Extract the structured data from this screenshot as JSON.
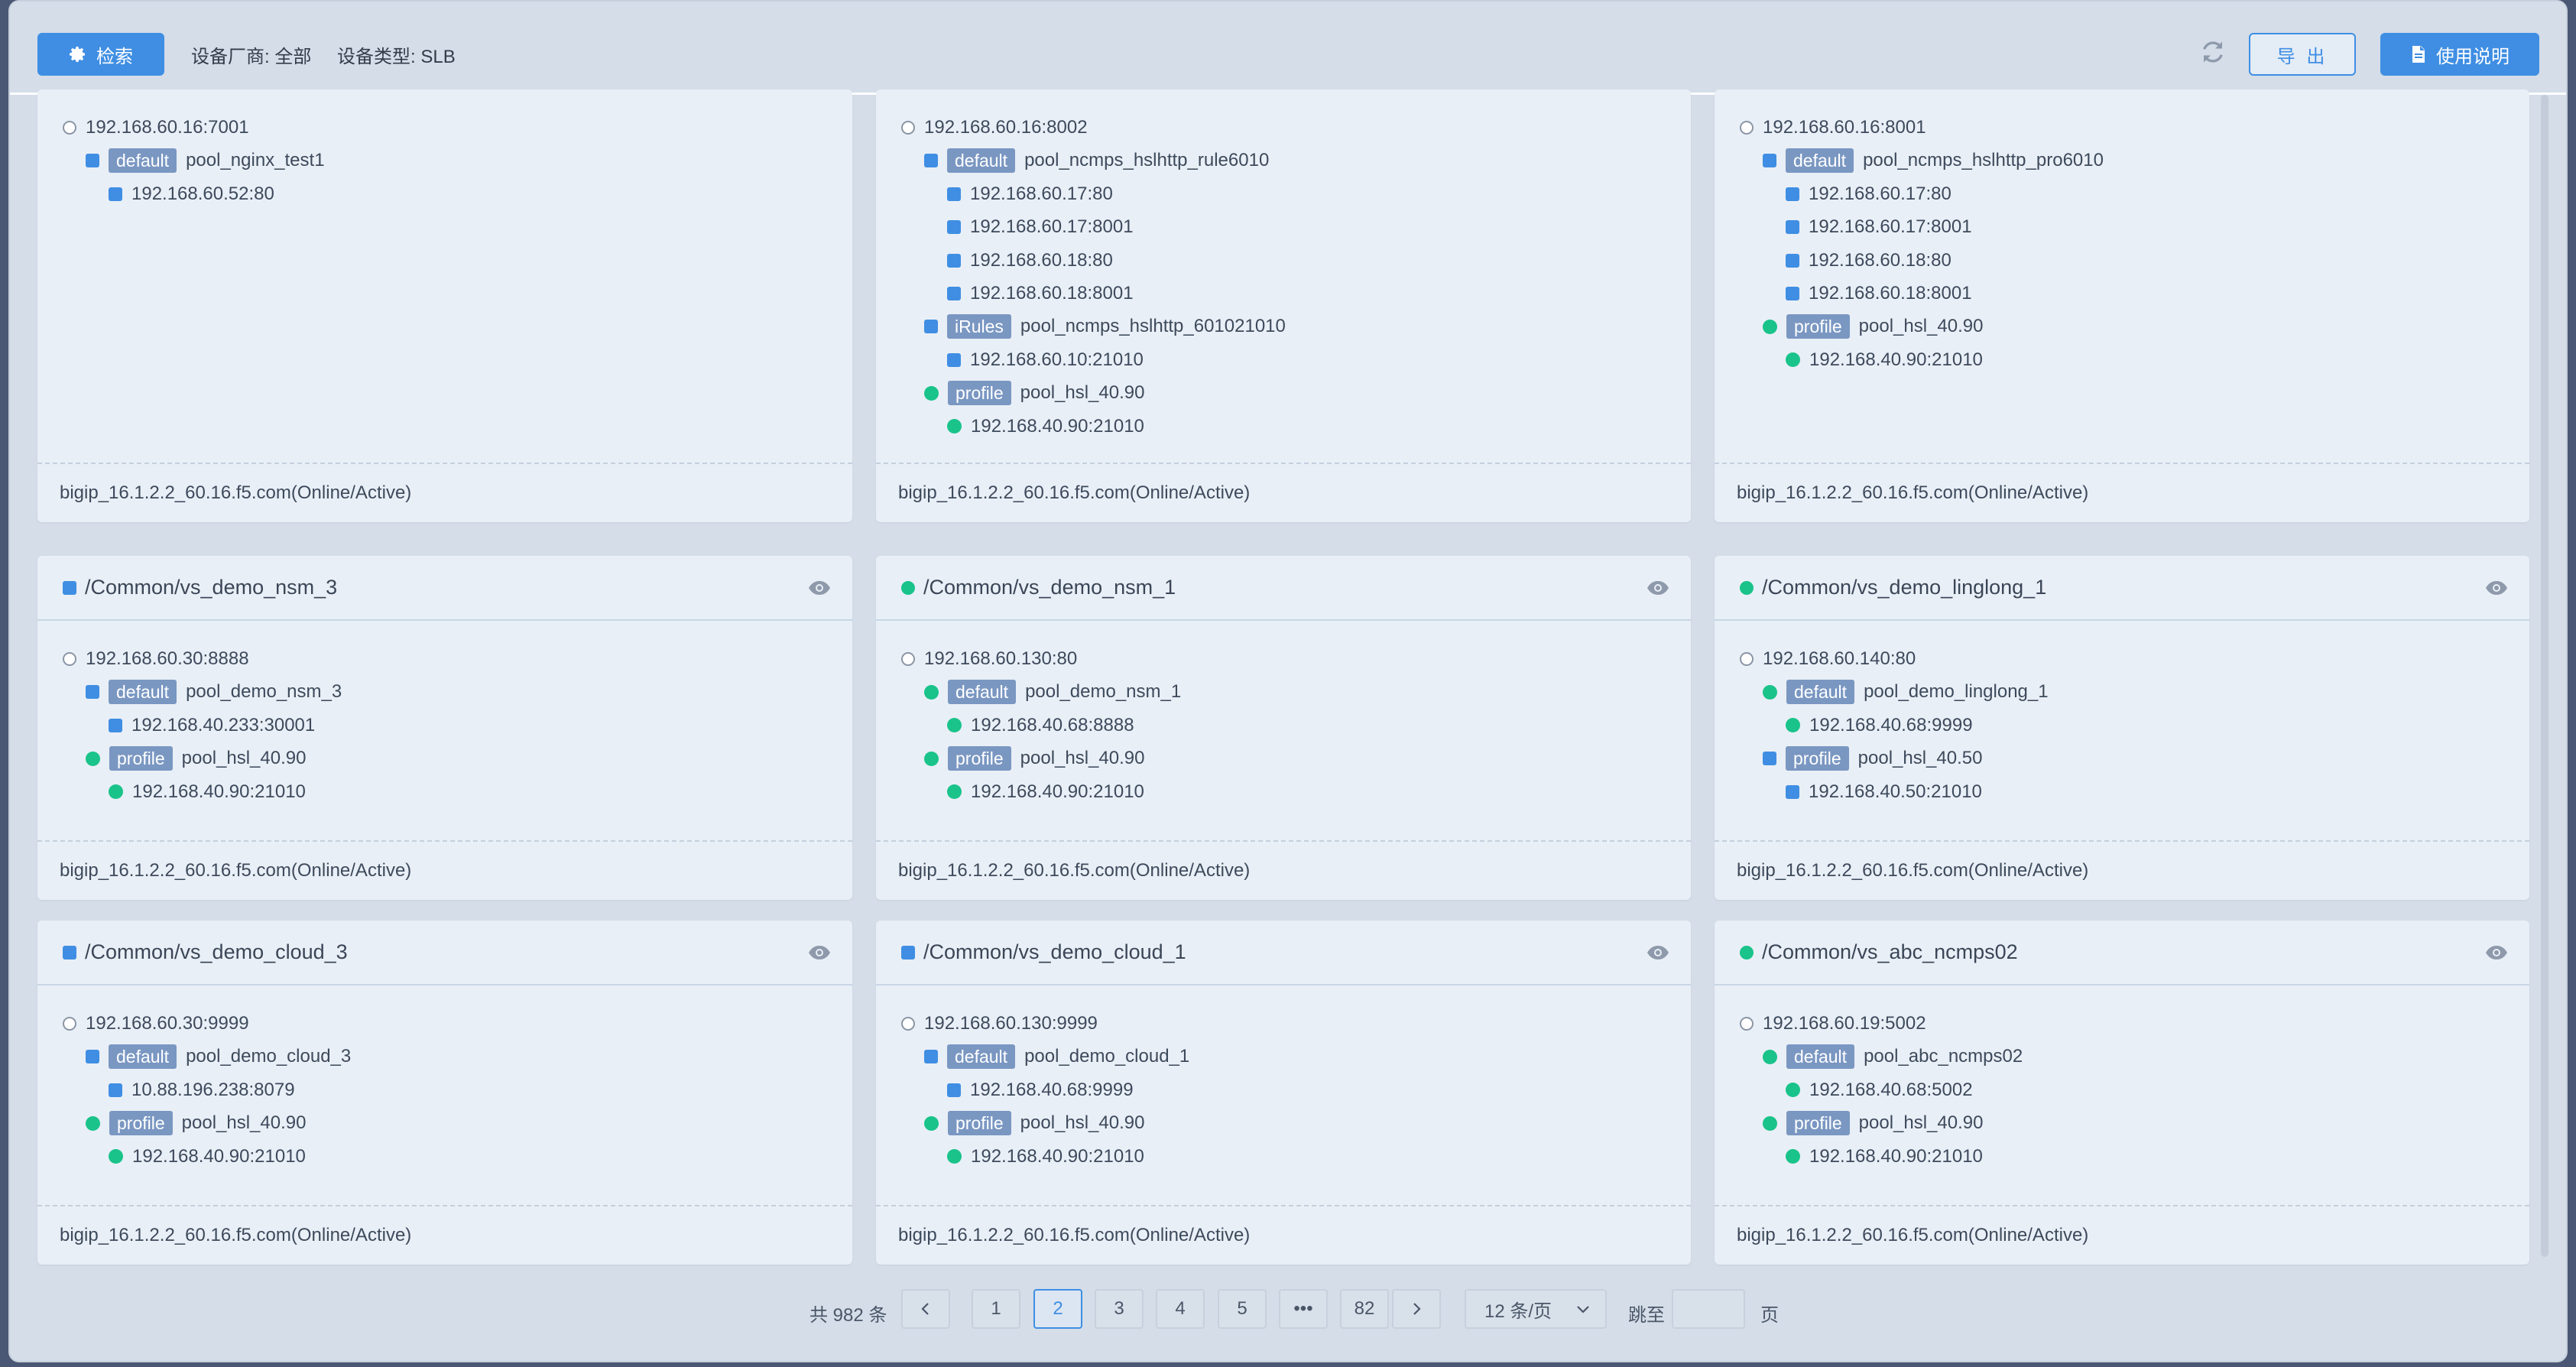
{
  "toolbar": {
    "search_label": "检索",
    "vendor_filter": "设备厂商: 全部",
    "type_filter": "设备类型: SLB",
    "export_label": "导 出",
    "help_label": "使用说明"
  },
  "cards": [
    {
      "title": null,
      "title_status": null,
      "nodes": [
        {
          "kind": "circle",
          "level": 0,
          "text": "192.168.60.16:7001"
        },
        {
          "kind": "square",
          "level": 1,
          "tag": "default",
          "text": "pool_nginx_test1"
        },
        {
          "kind": "square",
          "level": 2,
          "text": "192.168.60.52:80"
        }
      ],
      "footer": "bigip_16.1.2.2_60.16.f5.com(Online/Active)"
    },
    {
      "title": null,
      "title_status": null,
      "nodes": [
        {
          "kind": "circle",
          "level": 0,
          "text": "192.168.60.16:8002"
        },
        {
          "kind": "square",
          "level": 1,
          "tag": "default",
          "text": "pool_ncmps_hslhttp_rule6010"
        },
        {
          "kind": "square",
          "level": 2,
          "text": "192.168.60.17:80"
        },
        {
          "kind": "square",
          "level": 2,
          "text": "192.168.60.17:8001"
        },
        {
          "kind": "square",
          "level": 2,
          "text": "192.168.60.18:80"
        },
        {
          "kind": "square",
          "level": 2,
          "text": "192.168.60.18:8001"
        },
        {
          "kind": "square",
          "level": 1,
          "tag": "iRules",
          "text": "pool_ncmps_hslhttp_601021010"
        },
        {
          "kind": "square",
          "level": 2,
          "text": "192.168.60.10:21010"
        },
        {
          "kind": "dot",
          "level": 1,
          "tag": "profile",
          "text": "pool_hsl_40.90"
        },
        {
          "kind": "dot",
          "level": 2,
          "text": "192.168.40.90:21010"
        }
      ],
      "footer": "bigip_16.1.2.2_60.16.f5.com(Online/Active)"
    },
    {
      "title": null,
      "title_status": null,
      "nodes": [
        {
          "kind": "circle",
          "level": 0,
          "text": "192.168.60.16:8001"
        },
        {
          "kind": "square",
          "level": 1,
          "tag": "default",
          "text": "pool_ncmps_hslhttp_pro6010"
        },
        {
          "kind": "square",
          "level": 2,
          "text": "192.168.60.17:80"
        },
        {
          "kind": "square",
          "level": 2,
          "text": "192.168.60.17:8001"
        },
        {
          "kind": "square",
          "level": 2,
          "text": "192.168.60.18:80"
        },
        {
          "kind": "square",
          "level": 2,
          "text": "192.168.60.18:8001"
        },
        {
          "kind": "dot",
          "level": 1,
          "tag": "profile",
          "text": "pool_hsl_40.90"
        },
        {
          "kind": "dot",
          "level": 2,
          "text": "192.168.40.90:21010"
        }
      ],
      "footer": "bigip_16.1.2.2_60.16.f5.com(Online/Active)"
    },
    {
      "title": "/Common/vs_demo_nsm_3",
      "title_status": "square",
      "nodes": [
        {
          "kind": "circle",
          "level": 0,
          "text": "192.168.60.30:8888"
        },
        {
          "kind": "square",
          "level": 1,
          "tag": "default",
          "text": "pool_demo_nsm_3"
        },
        {
          "kind": "square",
          "level": 2,
          "text": "192.168.40.233:30001"
        },
        {
          "kind": "dot",
          "level": 1,
          "tag": "profile",
          "text": "pool_hsl_40.90"
        },
        {
          "kind": "dot",
          "level": 2,
          "text": "192.168.40.90:21010"
        }
      ],
      "footer": "bigip_16.1.2.2_60.16.f5.com(Online/Active)"
    },
    {
      "title": "/Common/vs_demo_nsm_1",
      "title_status": "dot",
      "nodes": [
        {
          "kind": "circle",
          "level": 0,
          "text": "192.168.60.130:80"
        },
        {
          "kind": "dot",
          "level": 1,
          "tag": "default",
          "text": "pool_demo_nsm_1"
        },
        {
          "kind": "dot",
          "level": 2,
          "text": "192.168.40.68:8888"
        },
        {
          "kind": "dot",
          "level": 1,
          "tag": "profile",
          "text": "pool_hsl_40.90"
        },
        {
          "kind": "dot",
          "level": 2,
          "text": "192.168.40.90:21010"
        }
      ],
      "footer": "bigip_16.1.2.2_60.16.f5.com(Online/Active)"
    },
    {
      "title": "/Common/vs_demo_linglong_1",
      "title_status": "dot",
      "nodes": [
        {
          "kind": "circle",
          "level": 0,
          "text": "192.168.60.140:80"
        },
        {
          "kind": "dot",
          "level": 1,
          "tag": "default",
          "text": "pool_demo_linglong_1"
        },
        {
          "kind": "dot",
          "level": 2,
          "text": "192.168.40.68:9999"
        },
        {
          "kind": "square",
          "level": 1,
          "tag": "profile",
          "text": "pool_hsl_40.50"
        },
        {
          "kind": "square",
          "level": 2,
          "text": "192.168.40.50:21010"
        }
      ],
      "footer": "bigip_16.1.2.2_60.16.f5.com(Online/Active)"
    },
    {
      "title": "/Common/vs_demo_cloud_3",
      "title_status": "square",
      "nodes": [
        {
          "kind": "circle",
          "level": 0,
          "text": "192.168.60.30:9999"
        },
        {
          "kind": "square",
          "level": 1,
          "tag": "default",
          "text": "pool_demo_cloud_3"
        },
        {
          "kind": "square",
          "level": 2,
          "text": "10.88.196.238:8079"
        },
        {
          "kind": "dot",
          "level": 1,
          "tag": "profile",
          "text": "pool_hsl_40.90"
        },
        {
          "kind": "dot",
          "level": 2,
          "text": "192.168.40.90:21010"
        }
      ],
      "footer": "bigip_16.1.2.2_60.16.f5.com(Online/Active)"
    },
    {
      "title": "/Common/vs_demo_cloud_1",
      "title_status": "square",
      "nodes": [
        {
          "kind": "circle",
          "level": 0,
          "text": "192.168.60.130:9999"
        },
        {
          "kind": "square",
          "level": 1,
          "tag": "default",
          "text": "pool_demo_cloud_1"
        },
        {
          "kind": "square",
          "level": 2,
          "text": "192.168.40.68:9999"
        },
        {
          "kind": "dot",
          "level": 1,
          "tag": "profile",
          "text": "pool_hsl_40.90"
        },
        {
          "kind": "dot",
          "level": 2,
          "text": "192.168.40.90:21010"
        }
      ],
      "footer": "bigip_16.1.2.2_60.16.f5.com(Online/Active)"
    },
    {
      "title": "/Common/vs_abc_ncmps02",
      "title_status": "dot",
      "nodes": [
        {
          "kind": "circle",
          "level": 0,
          "text": "192.168.60.19:5002"
        },
        {
          "kind": "dot",
          "level": 1,
          "tag": "default",
          "text": "pool_abc_ncmps02"
        },
        {
          "kind": "dot",
          "level": 2,
          "text": "192.168.40.68:5002"
        },
        {
          "kind": "dot",
          "level": 1,
          "tag": "profile",
          "text": "pool_hsl_40.90"
        },
        {
          "kind": "dot",
          "level": 2,
          "text": "192.168.40.90:21010"
        }
      ],
      "footer": "bigip_16.1.2.2_60.16.f5.com(Online/Active)"
    }
  ],
  "pagination": {
    "total": "共 982 条",
    "pages": [
      "1",
      "2",
      "3",
      "4",
      "5",
      "•••",
      "82"
    ],
    "current": "2",
    "page_size": "12 条/页",
    "jump_label": "跳至",
    "jump_value": "",
    "page_suffix": "页"
  },
  "colors": {
    "accent": "#3f8ee3",
    "status_ok": "#19c38a",
    "tag_bg": "#7a97c2"
  }
}
